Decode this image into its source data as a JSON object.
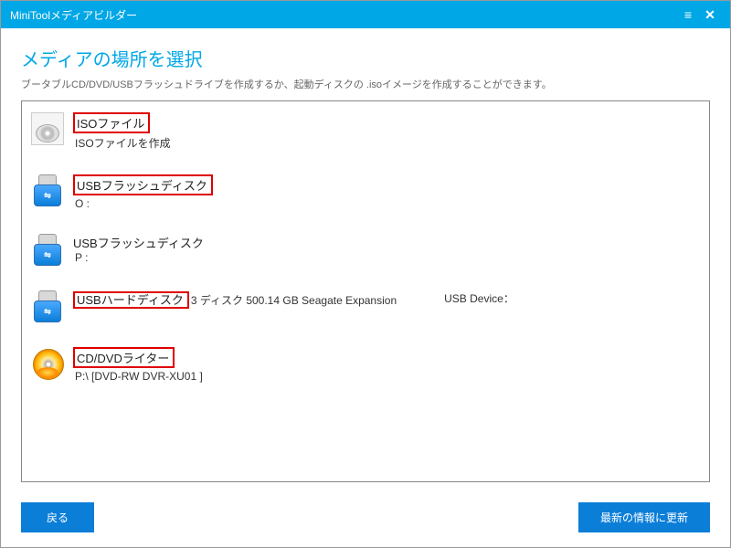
{
  "window": {
    "title": "MiniToolメディアビルダー"
  },
  "page": {
    "heading": "メディアの場所を選択",
    "subheading": "ブータブルCD/DVD/USBフラッシュドライブを作成するか、起動ディスクの .isoイメージを作成することができます。"
  },
  "options": {
    "iso": {
      "label": "ISOファイル",
      "sub": "ISOファイルを作成"
    },
    "usb_o": {
      "label": "USBフラッシュディスク",
      "sub": "O :"
    },
    "usb_p": {
      "label": "USBフラッシュディスク",
      "sub": "P :"
    },
    "usb_hdd": {
      "label": "USBハードディスク",
      "detail": "3 ディスク 500.14 GB Seagate  Expansion",
      "extra": "USB Device："
    },
    "dvd": {
      "label": "CD/DVDライター",
      "sub": "P:\\ [DVD-RW DVR-XU01 ]"
    }
  },
  "buttons": {
    "back": "戻る",
    "refresh": "最新の情報に更新"
  }
}
